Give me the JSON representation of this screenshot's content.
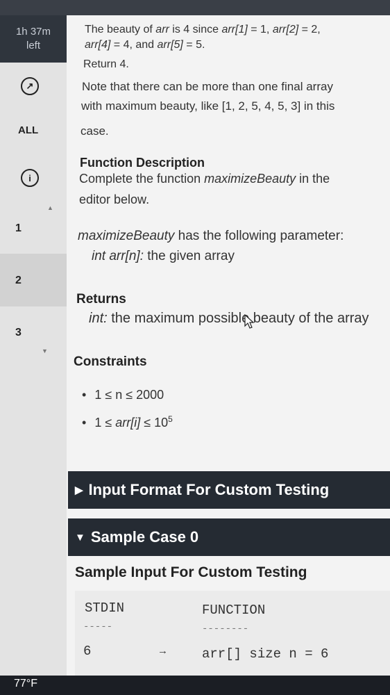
{
  "timer": {
    "line1": "1h 37m",
    "line2": "left"
  },
  "sidebar": {
    "all_label": "ALL",
    "questions": [
      "1",
      "2",
      "3"
    ]
  },
  "problem": {
    "line1_a": "The beauty of ",
    "line1_b": "arr",
    "line1_c": " is 4 since ",
    "line1_d": "arr[1]",
    "line1_e": " = 1, ",
    "line1_f": "arr[2]",
    "line1_g": " = 2,",
    "line2_a": "arr[4]",
    "line2_b": " = 4, and ",
    "line2_c": "arr[5]",
    "line2_d": " = 5.",
    "return_line": "Return 4.",
    "note_line1": "Note that there can be more than one final array",
    "note_line2": "with maximum beauty, like [1, 2, 5, 4, 5, 3] in this",
    "note_line3": "case.",
    "function_description_heading": "Function Description",
    "fd_line1_a": "Complete the function ",
    "fd_line1_b": "maximizeBeauty",
    "fd_line1_c": " in the",
    "fd_line2": "editor below.",
    "param_line_a": "maximizeBeauty",
    "param_line_b": " has the following parameter:",
    "param_detail_a": "int arr[n]:",
    "param_detail_b": " the given array",
    "returns_heading": "Returns",
    "returns_a": "int:",
    "returns_b": " the maximum possible beauty of the array",
    "constraints_heading": "Constraints",
    "constraint1": "1 ≤ n ≤ 2000",
    "constraint2_a": "1 ≤ ",
    "constraint2_b": "arr[i]",
    "constraint2_c": " ≤ 10",
    "constraint2_exp": "5"
  },
  "sections": {
    "input_format": "Input Format For Custom Testing",
    "sample_case": "Sample Case 0",
    "sample_input_heading": "Sample Input For Custom Testing"
  },
  "sample_table": {
    "col1_header": "STDIN",
    "col1_rule": "-----",
    "col2_header": "FUNCTION",
    "col2_rule": "--------",
    "row1_stdin": "6",
    "row1_arrow": "→",
    "row1_function": "arr[] size n = 6"
  },
  "taskbar": {
    "weather": "77°F"
  }
}
